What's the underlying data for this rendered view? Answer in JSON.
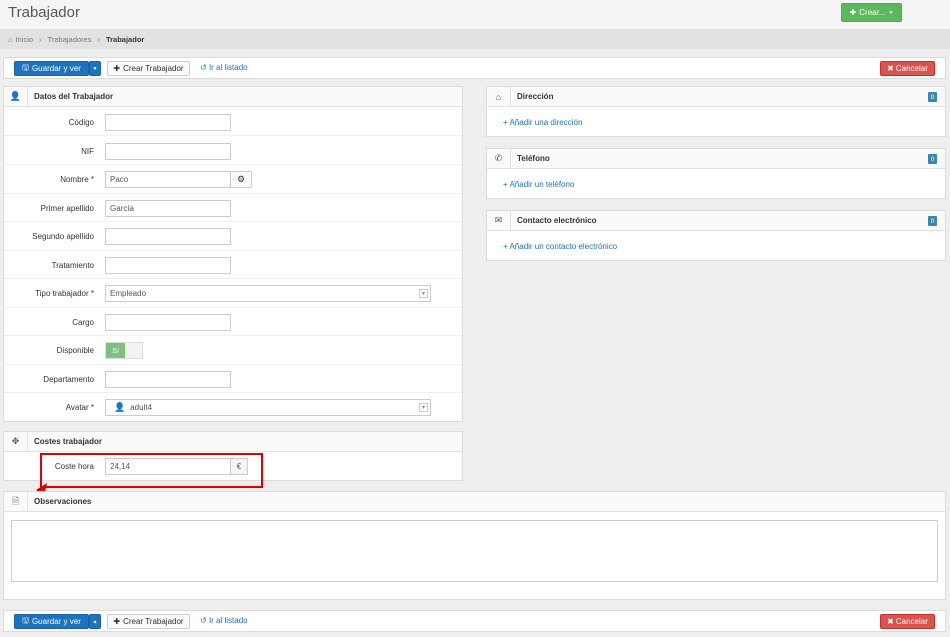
{
  "header": {
    "title": "Trabajador",
    "create_label": "Crear..."
  },
  "breadcrumb": {
    "home": "Inicio",
    "list": "Trabajadores",
    "current": "Trabajador"
  },
  "actions": {
    "save_label": "Guardar y ver",
    "create_label": "Crear Trabajador",
    "list_label": "Ir al listado",
    "cancel_label": "Cancelar"
  },
  "worker_panel": {
    "title": "Datos del Trabajador",
    "fields": {
      "codigo": {
        "label": "Código",
        "value": ""
      },
      "nif": {
        "label": "NIF",
        "value": ""
      },
      "nombre": {
        "label": "Nombre *",
        "value": "Paco"
      },
      "primer_apellido": {
        "label": "Primer apellido",
        "value": "García"
      },
      "segundo_apellido": {
        "label": "Segundo apellido",
        "value": ""
      },
      "tratamiento": {
        "label": "Tratamiento",
        "value": ""
      },
      "tipo": {
        "label": "Tipo trabajador *",
        "value": "Empleado"
      },
      "cargo": {
        "label": "Cargo",
        "value": ""
      },
      "disponible": {
        "label": "Disponible",
        "value": "Sí"
      },
      "departamento": {
        "label": "Departamento",
        "value": ""
      },
      "avatar": {
        "label": "Avatar *",
        "value": "adult4"
      }
    }
  },
  "costs_panel": {
    "title": "Costes trabajador",
    "coste_hora": {
      "label": "Coste hora",
      "value": "24,14",
      "unit": "€"
    }
  },
  "address_panel": {
    "title": "Dirección",
    "count": "0",
    "add_label": "+ Añadir una dirección"
  },
  "phone_panel": {
    "title": "Teléfono",
    "count": "0",
    "add_label": "+ Añadir un teléfono"
  },
  "contact_panel": {
    "title": "Contacto electrónico",
    "count": "0",
    "add_label": "+ Añadir un contacto electrónico"
  },
  "notes_panel": {
    "title": "Observaciones",
    "value": ""
  },
  "colors": {
    "primary": "#1e73be",
    "success": "#5cb85c",
    "danger": "#d9534f",
    "highlight": "#e00000"
  }
}
